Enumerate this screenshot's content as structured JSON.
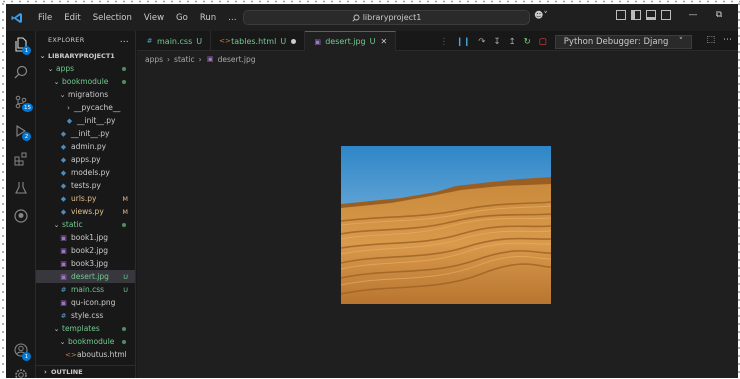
{
  "titlebar": {
    "menu": [
      "File",
      "Edit",
      "Selection",
      "View",
      "Go",
      "Run",
      "…"
    ],
    "search_text": "libraryproject1"
  },
  "activity_badges": {
    "explorer": "1",
    "scm": "15",
    "run": "2",
    "accounts": "1"
  },
  "sidebar": {
    "header": "EXPLORER",
    "header_more": "…",
    "project": "LIBRARYPROJECT1",
    "outline": "OUTLINE",
    "tree": [
      {
        "label": "apps",
        "type": "folder-open",
        "status": "dot"
      },
      {
        "label": "bookmodule",
        "type": "folder-open",
        "status": "dot"
      },
      {
        "label": "migrations",
        "type": "folder-open",
        "status": ""
      },
      {
        "label": "__pycache__",
        "type": "folder-closed",
        "status": ""
      },
      {
        "label": "__init__.py",
        "type": "py",
        "status": ""
      },
      {
        "label": "__init__.py",
        "type": "py",
        "status": ""
      },
      {
        "label": "admin.py",
        "type": "py",
        "status": ""
      },
      {
        "label": "apps.py",
        "type": "py",
        "status": ""
      },
      {
        "label": "models.py",
        "type": "py",
        "status": ""
      },
      {
        "label": "tests.py",
        "type": "py",
        "status": ""
      },
      {
        "label": "urls.py",
        "type": "py",
        "status": "M"
      },
      {
        "label": "views.py",
        "type": "py",
        "status": "M"
      },
      {
        "label": "static",
        "type": "folder-open",
        "status": "dot"
      },
      {
        "label": "book1.jpg",
        "type": "img",
        "status": ""
      },
      {
        "label": "book2.jpg",
        "type": "img",
        "status": ""
      },
      {
        "label": "book3.jpg",
        "type": "img",
        "status": ""
      },
      {
        "label": "desert.jpg",
        "type": "img",
        "status": "U"
      },
      {
        "label": "main.css",
        "type": "css",
        "status": "U"
      },
      {
        "label": "qu-icon.png",
        "type": "img",
        "status": ""
      },
      {
        "label": "style.css",
        "type": "css",
        "status": ""
      },
      {
        "label": "templates",
        "type": "folder-open",
        "status": "dot"
      },
      {
        "label": "bookmodule",
        "type": "folder-open",
        "status": "dot"
      },
      {
        "label": "aboutus.html",
        "type": "html",
        "status": ""
      }
    ]
  },
  "tabs": [
    {
      "label": "main.css",
      "status": "U"
    },
    {
      "label": "tables.html",
      "status": "U"
    },
    {
      "label": "desert.jpg",
      "status": "U"
    }
  ],
  "debug": {
    "config": "Python Debugger: Djang"
  },
  "breadcrumb": [
    "apps",
    "static",
    "desert.jpg"
  ],
  "colors": {
    "accent": "#0078d4",
    "untracked": "#73c991",
    "modified": "#e2c08d",
    "css": "#519aba",
    "html": "#e37933",
    "img": "#a074c4",
    "py": "#4b8bbe"
  }
}
